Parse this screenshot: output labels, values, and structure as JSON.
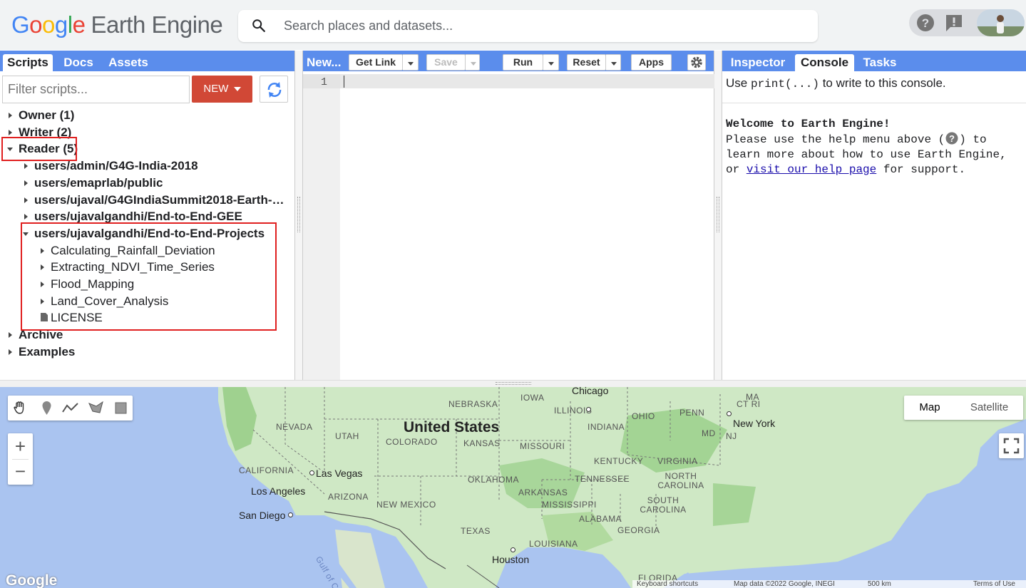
{
  "header": {
    "logo_google": "Google",
    "logo_product": "Earth Engine",
    "search_placeholder": "Search places and datasets...",
    "icons": [
      "help-icon",
      "feedback-icon"
    ]
  },
  "left_panel": {
    "tabs": [
      {
        "label": "Scripts",
        "active": true
      },
      {
        "label": "Docs",
        "active": false
      },
      {
        "label": "Assets",
        "active": false
      }
    ],
    "filter_placeholder": "Filter scripts...",
    "new_button": "NEW",
    "tree": [
      {
        "label": "Owner (1)",
        "level": 0,
        "state": "collapsed",
        "bold": true
      },
      {
        "label": "Writer (2)",
        "level": 0,
        "state": "collapsed",
        "bold": true
      },
      {
        "label": "Reader (5)",
        "level": 0,
        "state": "expanded",
        "bold": true
      },
      {
        "label": "users/admin/G4G-India-2018",
        "level": 1,
        "state": "collapsed",
        "bold": true
      },
      {
        "label": "users/emaprlab/public",
        "level": 1,
        "state": "collapsed",
        "bold": true
      },
      {
        "label": "users/ujaval/G4GIndiaSummit2018-Earth-E...",
        "level": 1,
        "state": "collapsed",
        "bold": true
      },
      {
        "label": "users/ujavalgandhi/End-to-End-GEE",
        "level": 1,
        "state": "collapsed",
        "bold": true
      },
      {
        "label": "users/ujavalgandhi/End-to-End-Projects",
        "level": 1,
        "state": "expanded",
        "bold": true
      },
      {
        "label": "Calculating_Rainfall_Deviation",
        "level": 2,
        "state": "collapsed",
        "bold": false
      },
      {
        "label": "Extracting_NDVI_Time_Series",
        "level": 2,
        "state": "collapsed",
        "bold": false
      },
      {
        "label": "Flood_Mapping",
        "level": 2,
        "state": "collapsed",
        "bold": false
      },
      {
        "label": "Land_Cover_Analysis",
        "level": 2,
        "state": "collapsed",
        "bold": false
      },
      {
        "label": "LICENSE",
        "level": 2,
        "state": "file",
        "bold": false
      },
      {
        "label": "Archive",
        "level": 0,
        "state": "collapsed",
        "bold": true
      },
      {
        "label": "Examples",
        "level": 0,
        "state": "collapsed",
        "bold": true
      }
    ]
  },
  "editor": {
    "title": "New...",
    "get_link": "Get Link",
    "save": "Save",
    "run": "Run",
    "reset": "Reset",
    "apps": "Apps",
    "line_number": "1"
  },
  "right_panel": {
    "tabs": [
      {
        "label": "Inspector",
        "active": false
      },
      {
        "label": "Console",
        "active": true
      },
      {
        "label": "Tasks",
        "active": false
      }
    ],
    "hint_prefix": "Use ",
    "hint_code": "print(...)",
    "hint_suffix": " to write to this console.",
    "welcome_title": "Welcome to Earth Engine!",
    "welcome_line1a": "Please use the help menu above (",
    "welcome_line1b": ") to",
    "welcome_line2": "learn more about how to use Earth Engine,",
    "welcome_line3a": "or ",
    "welcome_link": "visit our help page",
    "welcome_line3b": " for support."
  },
  "map": {
    "map_type": [
      "Map",
      "Satellite"
    ],
    "active_type": "Map",
    "zoom_in": "+",
    "zoom_out": "−",
    "country": "United States",
    "states": [
      "NEVADA",
      "UTAH",
      "COLORADO",
      "KANSAS",
      "NEBRASKA",
      "IOWA",
      "ILLINOIS",
      "OHIO",
      "PENN",
      "INDIANA",
      "MISSOURI",
      "KENTUCKY",
      "VIRGINIA",
      "TENNESSEE",
      "NORTH CAROLINA",
      "OKLAHOMA",
      "ARKANSAS",
      "SOUTH CAROLINA",
      "MISSISSIPPI",
      "ALABAMA",
      "GEORGIA",
      "TEXAS",
      "LOUISIANA",
      "CALIFORNIA",
      "ARIZONA",
      "NEW MEXICO",
      "MD",
      "NJ",
      "CT RI",
      "MA",
      "FLORIDA",
      "Gulf of Ca..."
    ],
    "cities": [
      "Chicago",
      "New York",
      "Las Vegas",
      "Los Angeles",
      "San Diego",
      "Houston"
    ],
    "google_mark": "Google",
    "attribution": [
      "Keyboard shortcuts",
      "Map data ©2022 Google, INEGI",
      "500 km",
      "Terms of Use"
    ]
  }
}
